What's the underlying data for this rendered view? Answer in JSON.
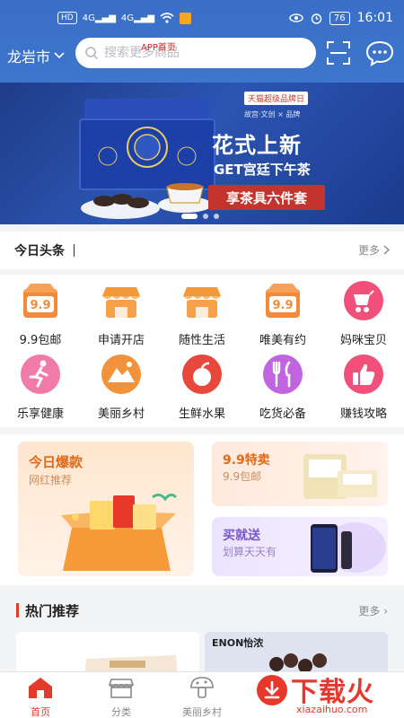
{
  "status_bar": {
    "hd_label": "HD",
    "signal_1": "4G",
    "signal_2": "4G",
    "battery": "76",
    "time": "16:01"
  },
  "header": {
    "city": "龙岩市",
    "search_placeholder": "搜索更多商品",
    "app_title": "APP首页",
    "scan_icon": "scan-icon",
    "chat_icon": "chat-bubble-icon",
    "bg_color": "#3a6fc6"
  },
  "banner": {
    "tag": "天猫超级品牌日",
    "brand_row": "故宫·文创  ×  品牌",
    "title": "花式上新",
    "subtitle": "GET宫廷下午茶",
    "promo": "享茶具六件套",
    "slide_count": 3,
    "active_slide": 0
  },
  "news": {
    "label": "今日头条",
    "more": "更多"
  },
  "categories": [
    {
      "label": "9.9包邮",
      "icon": "box-99-icon",
      "color": "#f28a3a"
    },
    {
      "label": "申请开店",
      "icon": "shop-icon",
      "color": "#f29a3a"
    },
    {
      "label": "随性生活",
      "icon": "shop-icon",
      "color": "#f29a3a"
    },
    {
      "label": "唯美有约",
      "icon": "box-99-icon",
      "color": "#f28a3a"
    },
    {
      "label": "妈咪宝贝",
      "icon": "stroller-icon",
      "color": "#f0507a"
    },
    {
      "label": "乐享健康",
      "icon": "running-icon",
      "color": "#f07aa8"
    },
    {
      "label": "美丽乡村",
      "icon": "mountain-icon",
      "color": "#f2923a"
    },
    {
      "label": "生鲜水果",
      "icon": "fruit-icon",
      "color": "#e8473b"
    },
    {
      "label": "吃货必备",
      "icon": "cutlery-icon",
      "color": "#c064e0"
    },
    {
      "label": "赚钱攻略",
      "icon": "thumbs-up-icon",
      "color": "#f0507a"
    }
  ],
  "promos": {
    "big": {
      "title": "今日爆款",
      "sub": "网红推荐"
    },
    "small1": {
      "title": "9.9特卖",
      "sub": "9.9包邮"
    },
    "small2": {
      "title": "买就送",
      "sub": "划算天天有"
    }
  },
  "hot": {
    "label": "热门推荐",
    "more": "更多",
    "prod2_brand": "ENON怡浓"
  },
  "tabbar": {
    "items": [
      {
        "label": "首页",
        "icon": "home-icon",
        "active": true
      },
      {
        "label": "分类",
        "icon": "category-shop-icon",
        "active": false
      },
      {
        "label": "美丽乡村",
        "icon": "mushroom-icon",
        "active": false
      }
    ],
    "accent": "#e23a2b"
  },
  "watermark": {
    "title": "下载火",
    "url": "xiazaihuo.com"
  }
}
